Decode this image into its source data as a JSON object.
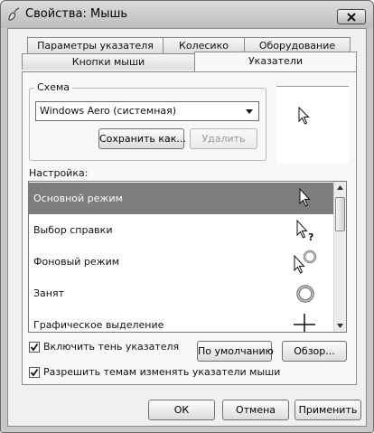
{
  "window": {
    "title": "Свойства: Мышь",
    "close_icon": "close-icon",
    "app_icon": "mouse-icon"
  },
  "tabs": [
    {
      "label": "Параметры указателя",
      "active": false
    },
    {
      "label": "Колесико",
      "active": false
    },
    {
      "label": "Оборудование",
      "active": false
    },
    {
      "label": "Кнопки мыши",
      "active": false
    },
    {
      "label": "Указатели",
      "active": true
    }
  ],
  "scheme": {
    "label": "Схема",
    "selected": "Windows Aero (системная)",
    "save_as_label": "Сохранить как...",
    "delete_label": "Удалить"
  },
  "setup": {
    "label": "Настройка:",
    "items": [
      {
        "label": "Основной режим",
        "icon": "arrow-cursor-icon",
        "selected": true
      },
      {
        "label": "Выбор справки",
        "icon": "help-cursor-icon",
        "selected": false
      },
      {
        "label": "Фоновый режим",
        "icon": "working-in-background-cursor-icon",
        "selected": false
      },
      {
        "label": "Занят",
        "icon": "busy-cursor-icon",
        "selected": false
      },
      {
        "label": "Графическое выделение",
        "icon": "crosshair-cursor-icon",
        "selected": false
      }
    ]
  },
  "options": {
    "shadow_label": "Включить тень указателя",
    "shadow_checked": true,
    "themes_label": "Разрешить темам изменять указатели мыши",
    "themes_checked": true,
    "default_label": "По умолчанию",
    "browse_label": "Обзор..."
  },
  "footer": {
    "ok_label": "ОК",
    "cancel_label": "Отмена",
    "apply_label": "Применить"
  }
}
